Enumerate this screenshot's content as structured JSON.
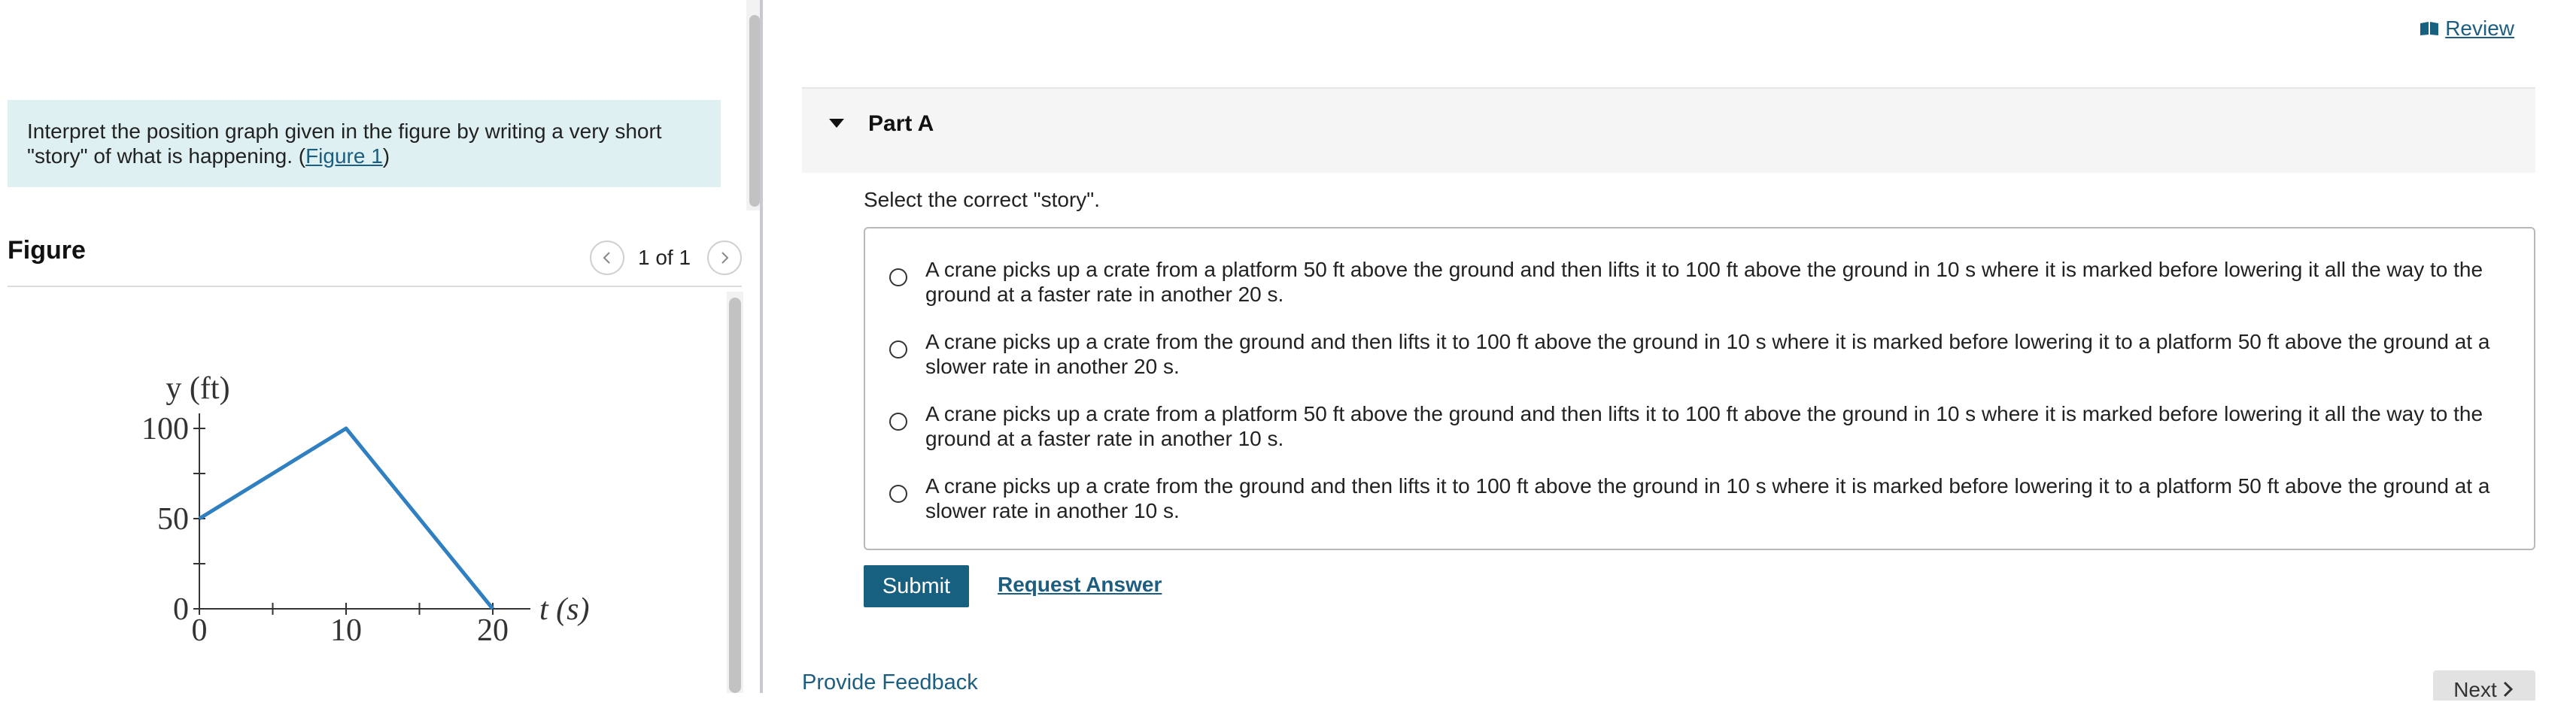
{
  "left_panel": {
    "prompt_text": "Interpret the position graph given in the figure by writing a very short \"story\" of what is happening. (",
    "prompt_link": "Figure 1",
    "prompt_close": ")",
    "figure_title": "Figure",
    "pager": "1 of 1",
    "icons": {
      "prev": "chevron-left-icon",
      "next": "chevron-right-icon"
    }
  },
  "chart_data": {
    "type": "line",
    "x": [
      0,
      10,
      20
    ],
    "y": [
      50,
      100,
      0
    ],
    "xlabel": "t (s)",
    "ylabel": "y (ft)",
    "xlim": [
      0,
      20
    ],
    "ylim": [
      0,
      100
    ],
    "xticks": [
      "0",
      "10",
      "20"
    ],
    "yticks": [
      "0",
      "50",
      "100"
    ],
    "line_color": "#2f7fc1"
  },
  "header": {
    "review_label": "Review",
    "review_icon": "book-icon"
  },
  "part": {
    "title": "Part A",
    "instruction": "Select the correct \"story\".",
    "choices": [
      "A crane picks up a crate from a platform 50 ft above the ground and then lifts it to 100 ft above the ground in 10 s where it is marked before lowering it all the way to the ground at a faster rate in another 20 s.",
      "A crane picks up a crate from the ground and then lifts it to 100 ft above the ground in 10 s where it is marked before lowering it to a platform 50 ft above the ground at a slower rate in another 20 s.",
      "A crane picks up a crate from a platform 50 ft above the ground and then lifts it to 100 ft above the ground in 10 s where it is marked before lowering it all the way to the ground at a faster rate in another 10 s.",
      "A crane picks up a crate from the ground and then lifts it to 100 ft above the ground in 10 s where it is marked before lowering it to a platform 50 ft above the ground at a slower rate in another 10 s."
    ],
    "submit_label": "Submit",
    "request_label": "Request Answer"
  },
  "footer": {
    "feedback_label": "Provide Feedback",
    "next_label": "Next"
  },
  "colors": {
    "accent": "#17607f",
    "link": "#1d5e80",
    "prompt_bg": "#def0f1"
  }
}
